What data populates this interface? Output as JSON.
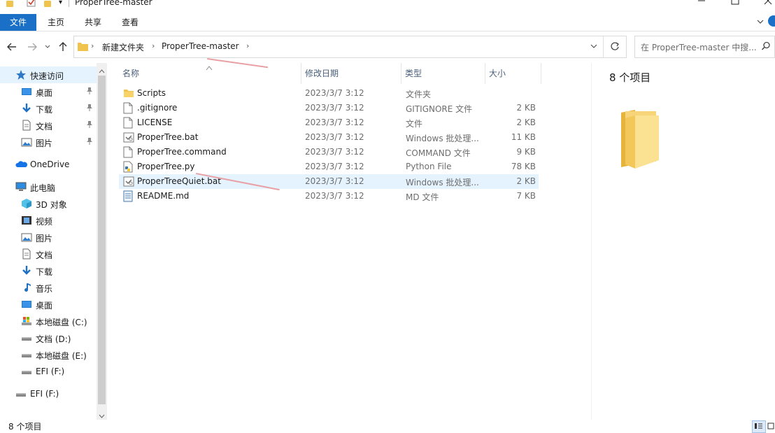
{
  "window": {
    "title": "ProperTree-master"
  },
  "ribbon": {
    "tabs": [
      "文件",
      "主页",
      "共享",
      "查看"
    ]
  },
  "address": {
    "crumbs": [
      "新建文件夹",
      "ProperTree-master"
    ],
    "search_placeholder": "在 ProperTree-master 中搜..."
  },
  "sidebar": {
    "items": [
      {
        "label": "快速访问",
        "icon": "star-icon",
        "indent": 1,
        "pinned": false,
        "selected": true
      },
      {
        "label": "桌面",
        "icon": "desktop-icon",
        "indent": 2,
        "pinned": true
      },
      {
        "label": "下载",
        "icon": "download-arrow-icon",
        "indent": 2,
        "pinned": true
      },
      {
        "label": "文档",
        "icon": "document-icon",
        "indent": 2,
        "pinned": true
      },
      {
        "label": "图片",
        "icon": "picture-icon",
        "indent": 2,
        "pinned": true
      },
      {
        "label": "OneDrive",
        "icon": "cloud-icon",
        "indent": 1,
        "pinned": false
      },
      {
        "label": "此电脑",
        "icon": "computer-icon",
        "indent": 1,
        "pinned": false
      },
      {
        "label": "3D 对象",
        "icon": "cube-3d-icon",
        "indent": 2,
        "pinned": false
      },
      {
        "label": "视频",
        "icon": "video-icon",
        "indent": 2,
        "pinned": false
      },
      {
        "label": "图片",
        "icon": "picture-icon",
        "indent": 2,
        "pinned": false
      },
      {
        "label": "文档",
        "icon": "document-icon",
        "indent": 2,
        "pinned": false
      },
      {
        "label": "下载",
        "icon": "download-arrow-icon",
        "indent": 2,
        "pinned": false
      },
      {
        "label": "音乐",
        "icon": "music-note-icon",
        "indent": 2,
        "pinned": false
      },
      {
        "label": "桌面",
        "icon": "desktop-icon",
        "indent": 2,
        "pinned": false
      },
      {
        "label": "本地磁盘 (C:)",
        "icon": "system-drive-icon",
        "indent": 2,
        "pinned": false
      },
      {
        "label": "文档 (D:)",
        "icon": "drive-icon",
        "indent": 2,
        "pinned": false
      },
      {
        "label": "本地磁盘 (E:)",
        "icon": "drive-icon",
        "indent": 2,
        "pinned": false
      },
      {
        "label": "EFI (F:)",
        "icon": "drive-icon",
        "indent": 2,
        "pinned": false
      },
      {
        "label": "EFI (F:)",
        "icon": "drive-icon",
        "indent": 1,
        "pinned": false
      }
    ]
  },
  "columns": {
    "name": "名称",
    "date": "修改日期",
    "type": "类型",
    "size": "大小"
  },
  "files": [
    {
      "name": "Scripts",
      "date": "2023/3/7 3:12",
      "type": "文件夹",
      "size": "",
      "icon": "folder-icon"
    },
    {
      "name": ".gitignore",
      "date": "2023/3/7 3:12",
      "type": "GITIGNORE 文件",
      "size": "2 KB",
      "icon": "blank-file-icon"
    },
    {
      "name": "LICENSE",
      "date": "2023/3/7 3:12",
      "type": "文件",
      "size": "2 KB",
      "icon": "blank-file-icon"
    },
    {
      "name": "ProperTree.bat",
      "date": "2023/3/7 3:12",
      "type": "Windows 批处理...",
      "size": "11 KB",
      "icon": "batch-file-icon"
    },
    {
      "name": "ProperTree.command",
      "date": "2023/3/7 3:12",
      "type": "COMMAND 文件",
      "size": "9 KB",
      "icon": "blank-file-icon"
    },
    {
      "name": "ProperTree.py",
      "date": "2023/3/7 3:12",
      "type": "Python File",
      "size": "78 KB",
      "icon": "python-file-icon"
    },
    {
      "name": "ProperTreeQuiet.bat",
      "date": "2023/3/7 3:12",
      "type": "Windows 批处理...",
      "size": "2 KB",
      "icon": "batch-file-icon",
      "selected": true
    },
    {
      "name": "README.md",
      "date": "2023/3/7 3:12",
      "type": "MD 文件",
      "size": "7 KB",
      "icon": "text-file-icon"
    }
  ],
  "preview": {
    "count_label": "8 个项目"
  },
  "status": {
    "count_label": "8 个项目"
  },
  "colors": {
    "accent": "#1a6fc6",
    "selection": "#e5f3ff",
    "folder": "#f0c44c",
    "annotation": "#e8a0a4"
  }
}
